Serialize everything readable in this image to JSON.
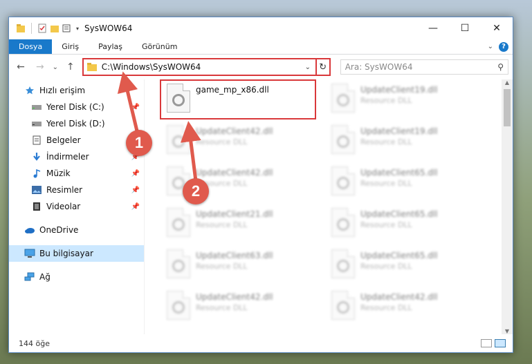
{
  "window": {
    "title": "SysWOW64"
  },
  "ribbon": {
    "tabs": [
      "Dosya",
      "Giriş",
      "Paylaş",
      "Görünüm"
    ],
    "help": "?"
  },
  "window_controls": {
    "minimize": "—",
    "maximize": "☐",
    "close": "✕"
  },
  "navbar": {
    "back": "←",
    "forward": "→",
    "up_dropdown": "⌄",
    "up": "↑",
    "address": "C:\\Windows\\SysWOW64",
    "refresh": "↻",
    "search_placeholder": "Ara: SysWOW64"
  },
  "sidebar": {
    "items": [
      {
        "label": "Hızlı erişim",
        "icon": "star-icon"
      },
      {
        "label": "Yerel Disk (C:)",
        "icon": "drive-icon",
        "pinned": true
      },
      {
        "label": "Yerel Disk (D:)",
        "icon": "drive-icon",
        "pinned": true
      },
      {
        "label": "Belgeler",
        "icon": "documents-icon",
        "pinned": true
      },
      {
        "label": "İndirmeler",
        "icon": "download-icon",
        "pinned": true
      },
      {
        "label": "Müzik",
        "icon": "music-icon",
        "pinned": true
      },
      {
        "label": "Resimler",
        "icon": "pictures-icon",
        "pinned": true
      },
      {
        "label": "Videolar",
        "icon": "video-icon",
        "pinned": true
      },
      {
        "label": "OneDrive",
        "icon": "cloud-icon"
      },
      {
        "label": "Bu bilgisayar",
        "icon": "computer-icon",
        "selected": true
      },
      {
        "label": "Ağ",
        "icon": "network-icon"
      }
    ]
  },
  "files": {
    "highlighted": {
      "name": "game_mp_x86.dll",
      "type": ""
    },
    "left_column": [
      {
        "name": "UpdateClient42.dll",
        "type": "Resource DLL"
      },
      {
        "name": "UpdateClient42.dll",
        "type": "Resource DLL"
      },
      {
        "name": "UpdateClient21.dll",
        "type": "Resource DLL"
      },
      {
        "name": "UpdateClient63.dll",
        "type": "Resource DLL"
      },
      {
        "name": "UpdateClient42.dll",
        "type": "Resource DLL"
      }
    ],
    "right_column": [
      {
        "name": "UpdateClient19.dll",
        "type": "Resource DLL"
      },
      {
        "name": "UpdateClient19.dll",
        "type": "Resource DLL"
      },
      {
        "name": "UpdateClient65.dll",
        "type": "Resource DLL"
      },
      {
        "name": "UpdateClient65.dll",
        "type": "Resource DLL"
      },
      {
        "name": "UpdateClient65.dll",
        "type": "Resource DLL"
      },
      {
        "name": "UpdateClient42.dll",
        "type": "Resource DLL"
      }
    ]
  },
  "status": {
    "count": "144 öğe"
  },
  "annotations": {
    "marker1": "1",
    "marker2": "2",
    "color": "#e05a4d"
  }
}
